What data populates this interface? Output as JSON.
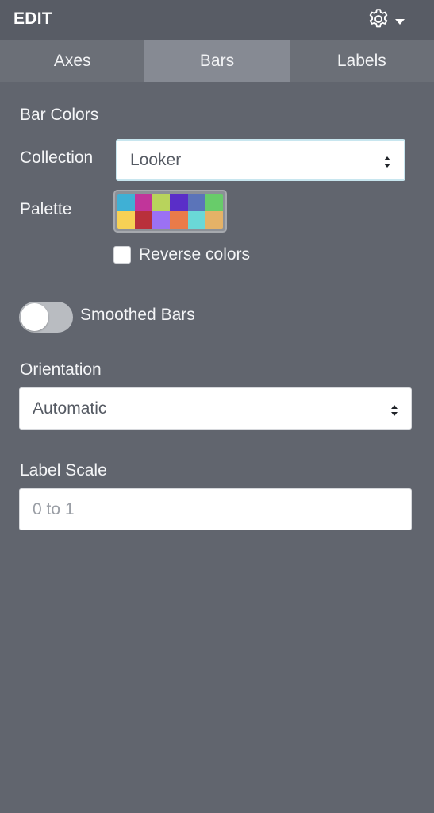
{
  "header": {
    "title": "EDIT",
    "gear_icon": "gear-icon",
    "caret_icon": "caret-down-icon"
  },
  "tabs": [
    {
      "label": "Axes",
      "active": false
    },
    {
      "label": "Bars",
      "active": true
    },
    {
      "label": "Labels",
      "active": false
    }
  ],
  "bar_colors": {
    "heading": "Bar Colors",
    "collection_label": "Collection",
    "collection_value": "Looker",
    "palette_label": "Palette",
    "palette_colors": [
      "#3fb0d5",
      "#c1359a",
      "#b8d35c",
      "#5a2ec8",
      "#5b74b9",
      "#68cc6a",
      "#f7d155",
      "#b9303b",
      "#9b71f4",
      "#ea7b49",
      "#6ad8d7",
      "#e5b267"
    ],
    "reverse_label": "Reverse colors",
    "reverse_checked": false
  },
  "smoothed": {
    "label": "Smoothed Bars",
    "on": false
  },
  "orientation": {
    "label": "Orientation",
    "value": "Automatic"
  },
  "label_scale": {
    "label": "Label Scale",
    "placeholder": "0 to 1"
  }
}
